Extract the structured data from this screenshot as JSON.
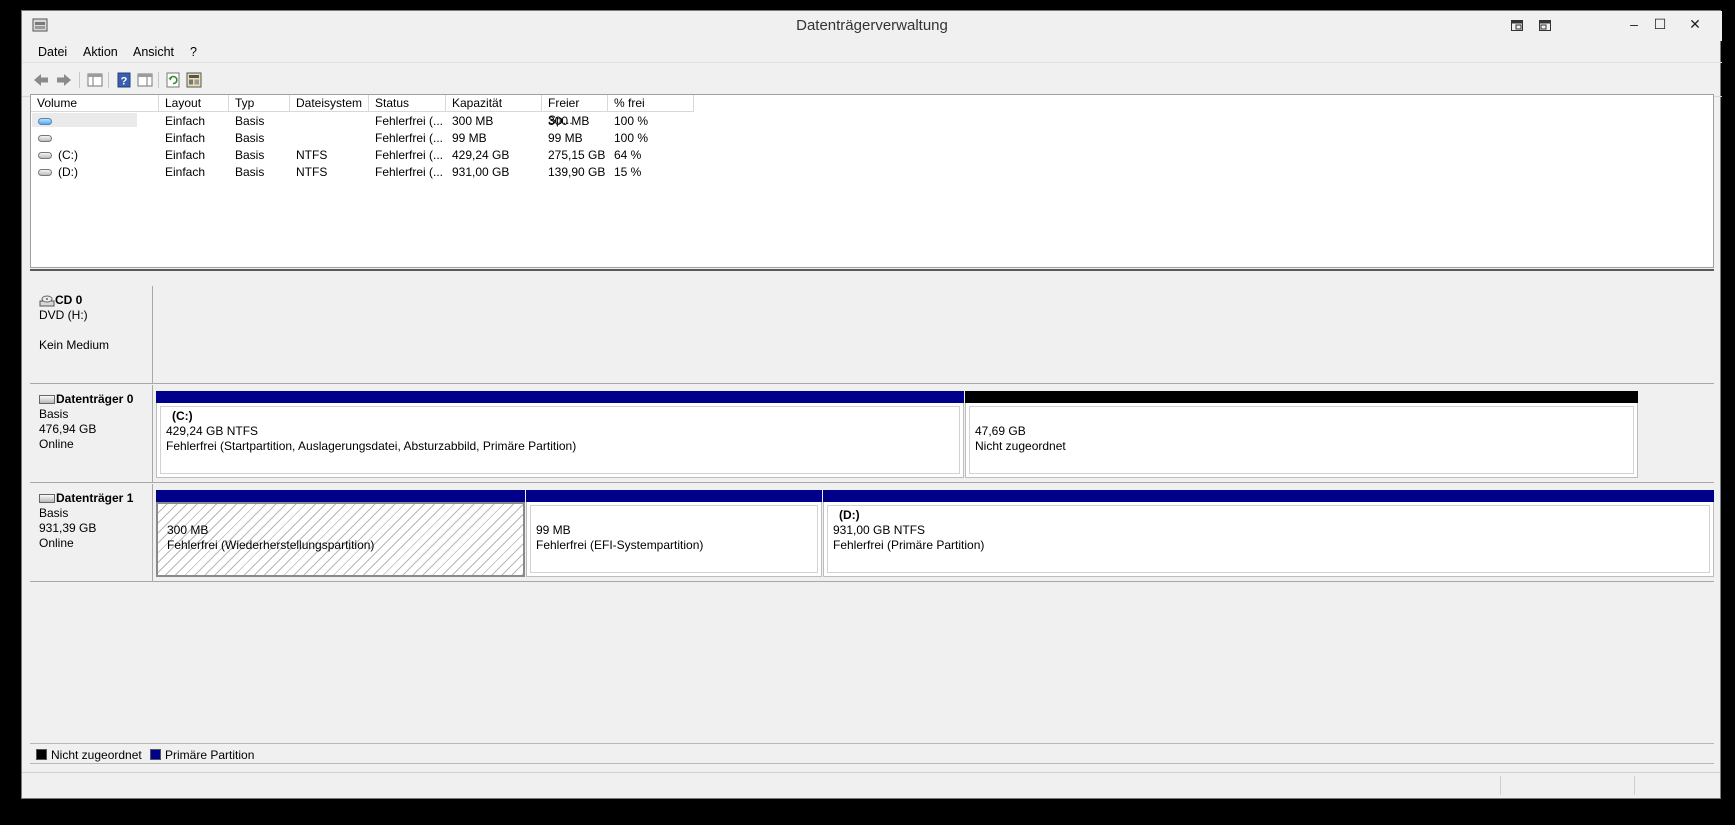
{
  "window": {
    "title": "Datenträgerverwaltung"
  },
  "titlebar": {
    "minimize": "–",
    "maximize": "☐",
    "close": "✕"
  },
  "menu": [
    "Datei",
    "Aktion",
    "Ansicht",
    "?"
  ],
  "table": {
    "columns": [
      "Volume",
      "Layout",
      "Typ",
      "Dateisystem",
      "Status",
      "Kapazität",
      "Freier Sp...",
      "% frei"
    ],
    "rows": [
      {
        "volume": "",
        "icon": "blue",
        "layout": "Einfach",
        "typ": "Basis",
        "fs": "",
        "status": "Fehlerfrei (...",
        "cap": "300 MB",
        "free": "300 MB",
        "pct": "100 %"
      },
      {
        "volume": "",
        "icon": "gray",
        "layout": "Einfach",
        "typ": "Basis",
        "fs": "",
        "status": "Fehlerfrei (...",
        "cap": "99 MB",
        "free": "99 MB",
        "pct": "100 %"
      },
      {
        "volume": "(C:)",
        "icon": "gray",
        "layout": "Einfach",
        "typ": "Basis",
        "fs": "NTFS",
        "status": "Fehlerfrei (...",
        "cap": "429,24 GB",
        "free": "275,15 GB",
        "pct": "64 %"
      },
      {
        "volume": "(D:)",
        "icon": "gray",
        "layout": "Einfach",
        "typ": "Basis",
        "fs": "NTFS",
        "status": "Fehlerfrei (...",
        "cap": "931,00 GB",
        "free": "139,90 GB",
        "pct": "15 %"
      }
    ]
  },
  "disks": {
    "cd0": {
      "title": "CD 0",
      "line1": "DVD (H:)",
      "line2": "Kein Medium"
    },
    "disk0": {
      "title": "Datenträger 0",
      "type": "Basis",
      "size": "476,94 GB",
      "state": "Online",
      "p1": {
        "title": "(C:)",
        "line1": "429,24 GB NTFS",
        "line2": "Fehlerfrei (Startpartition, Auslagerungsdatei, Absturzabbild, Primäre Partition)"
      },
      "p2": {
        "line1": "47,69 GB",
        "line2": "Nicht zugeordnet"
      }
    },
    "disk1": {
      "title": "Datenträger 1",
      "type": "Basis",
      "size": "931,39 GB",
      "state": "Online",
      "p1": {
        "line1": "300 MB",
        "line2": "Fehlerfrei (Wiederherstellungspartition)"
      },
      "p2": {
        "line1": "99 MB",
        "line2": "Fehlerfrei (EFI-Systempartition)"
      },
      "p3": {
        "title": "(D:)",
        "line1": "931,00 GB NTFS",
        "line2": "Fehlerfrei (Primäre Partition)"
      }
    }
  },
  "legend": {
    "unallocated": "Nicht zugeordnet",
    "primary": "Primäre Partition"
  },
  "colors": {
    "primary": "#00008b",
    "unallocated": "#000000"
  }
}
